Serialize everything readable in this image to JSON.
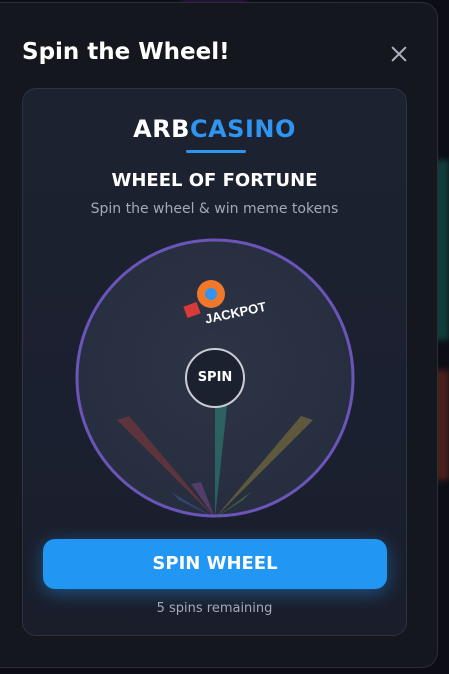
{
  "modal": {
    "title": "Spin the Wheel!",
    "close_icon": "close-icon"
  },
  "card": {
    "brand_part1": "ARB",
    "brand_part2": "CASINO",
    "heading": "WHEEL OF FORTUNE",
    "subheading": "Spin the wheel & win meme tokens",
    "wheel_center_label": "SPIN",
    "wheel_labels": [
      "JACKPOT"
    ],
    "spin_button_label": "SPIN WHEEL",
    "spins_remaining": "5 spins remaining"
  },
  "colors": {
    "accent": "#2196f3",
    "brand_blue": "#2f95f0",
    "wheel_ring": "#6b55b8",
    "modal_bg": "#15171e"
  }
}
